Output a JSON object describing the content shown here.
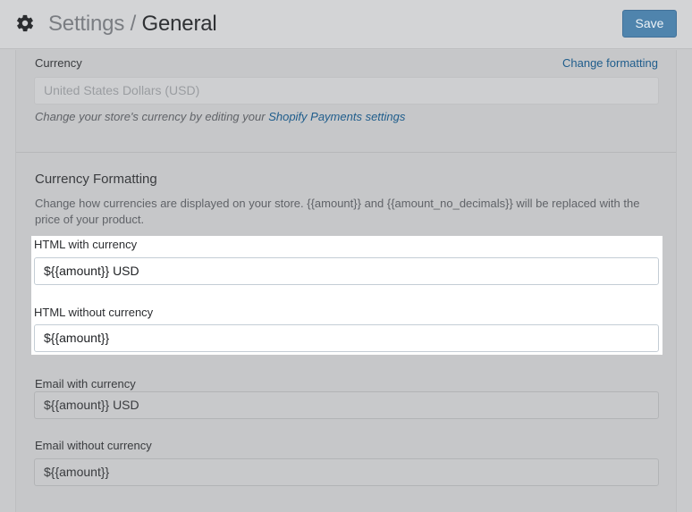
{
  "header": {
    "crumb": "Settings",
    "separator": "/",
    "current": "General",
    "save_label": "Save",
    "icon": "gear-icon"
  },
  "currency": {
    "label": "Currency",
    "change_link": "Change formatting",
    "value": "United States Dollars (USD)",
    "help_prefix": "Change your store's currency by editing your",
    "help_link": "Shopify Payments settings"
  },
  "formatting": {
    "heading": "Currency Formatting",
    "description": "Change how currencies are displayed on your store. {{amount}} and {{amount_no_decimals}} will be replaced with the price of your product.",
    "html_with_currency": {
      "label": "HTML with currency",
      "value": "${{amount}} USD"
    },
    "html_without_currency": {
      "label": "HTML without currency",
      "value": "${{amount}}"
    },
    "email_with_currency": {
      "label": "Email with currency",
      "value": "${{amount}} USD"
    },
    "email_without_currency": {
      "label": "Email without currency",
      "value": "${{amount}}"
    }
  },
  "colors": {
    "accent": "#4f84ad",
    "link": "#1f5d8c",
    "overlay": "#c9cacc",
    "highlight": "#ffffff"
  }
}
